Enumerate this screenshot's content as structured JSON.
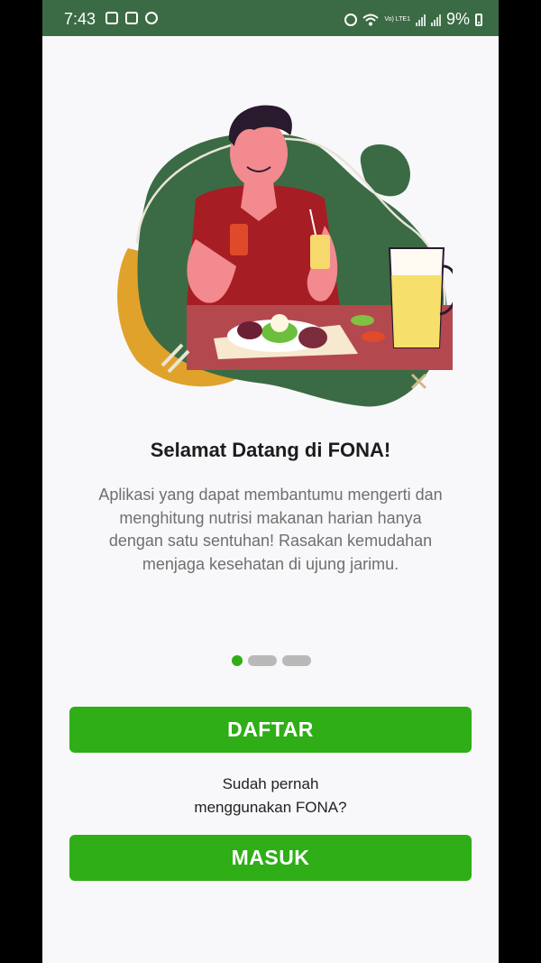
{
  "status_bar": {
    "time": "7:43",
    "battery_percent": "9%",
    "network_label": "Vo) LTE1",
    "left_icons": [
      "screenshot-icon",
      "gallery-icon",
      "dnd-icon"
    ],
    "right_icons": [
      "alarm-icon",
      "wifi-icon",
      "volte-icon",
      "signal-icon",
      "signal-icon",
      "battery-icon"
    ]
  },
  "onboarding": {
    "title": "Selamat Datang di FONA!",
    "description": "Aplikasi yang dapat membantumu mengerti dan menghitung nutrisi makanan harian hanya dengan satu sentuhan! Rasakan kemudahan menjaga kesehatan di ujung jarimu.",
    "page_index": 1,
    "page_count": 3
  },
  "actions": {
    "register_label": "DAFTAR",
    "question_line1": "Sudah pernah",
    "question_line2": "menggunakan FONA?",
    "login_label": "MASUK"
  },
  "colors": {
    "status_bar": "#3b6b44",
    "primary": "#2fae17",
    "background": "#f8f8fb",
    "dot_inactive": "#b9b9b9"
  }
}
